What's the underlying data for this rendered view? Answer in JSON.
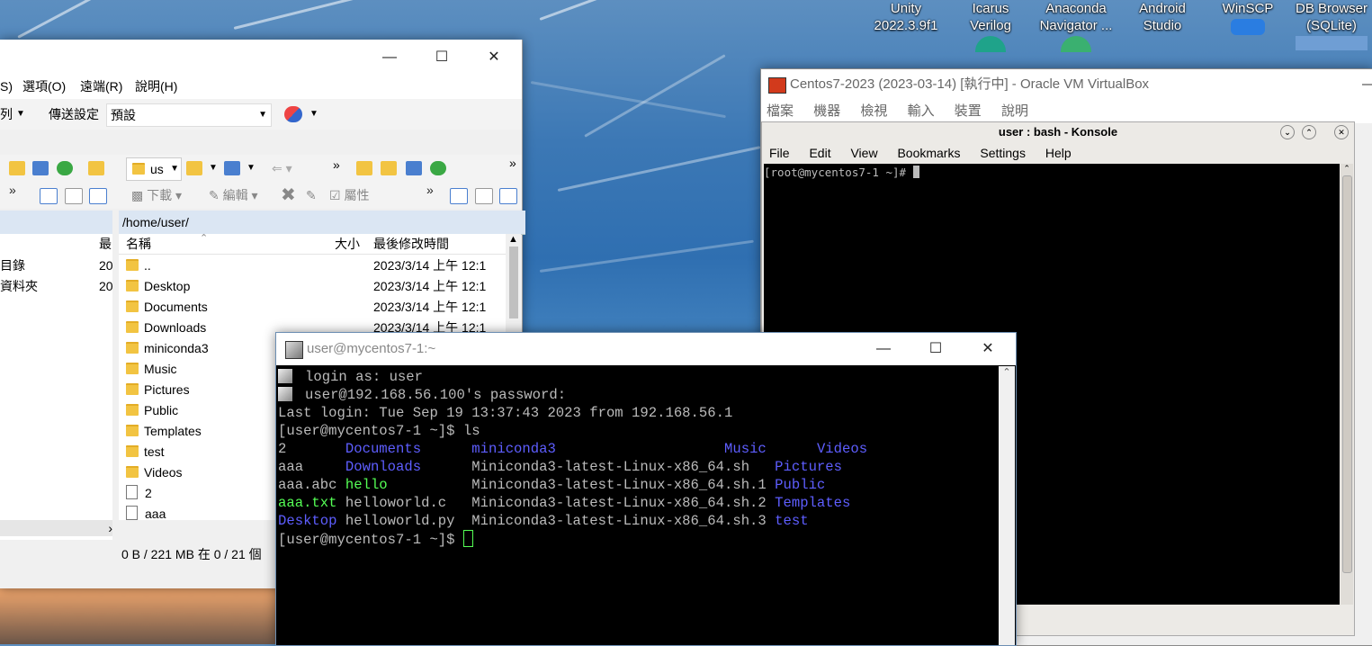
{
  "desktop": {
    "icons": [
      {
        "label1": "Unity",
        "label2": "2022.3.9f1"
      },
      {
        "label1": "Icarus",
        "label2": "Verilog"
      },
      {
        "label1": "Anaconda",
        "label2": "Navigator ..."
      },
      {
        "label1": "Android",
        "label2": "Studio"
      },
      {
        "label1": "WinSCP",
        "label2": ""
      },
      {
        "label1": "DB Browser",
        "label2": "(SQLite)"
      }
    ]
  },
  "winscp": {
    "menu": [
      "S)",
      "選項(O)",
      "遠端(R)",
      "說明(H)"
    ],
    "toolbar": {
      "left_cut": "列",
      "transfer_label": "傳送設定",
      "transfer_value": "預設"
    },
    "toolbar2": {
      "path_combo": "us",
      "download": "下載",
      "edit": "編輯",
      "properties": "屬性"
    },
    "left_panel": {
      "col_last": "最",
      "rows": [
        {
          "name": "目錄",
          "date": "20"
        },
        {
          "name": "資料夾",
          "date": "20"
        }
      ]
    },
    "right_panel": {
      "path": "/home/user/",
      "headers": {
        "name": "名稱",
        "size": "大小",
        "modified": "最後修改時間"
      },
      "rows": [
        {
          "type": "parent",
          "name": "..",
          "modified": "2023/3/14 上午 12:1"
        },
        {
          "type": "folder",
          "name": "Desktop",
          "modified": "2023/3/14 上午 12:1"
        },
        {
          "type": "folder",
          "name": "Documents",
          "modified": "2023/3/14 上午 12:1"
        },
        {
          "type": "folder",
          "name": "Downloads",
          "modified": "2023/3/14 上午 12:1"
        },
        {
          "type": "folder",
          "name": "miniconda3",
          "modified": ""
        },
        {
          "type": "folder",
          "name": "Music",
          "modified": ""
        },
        {
          "type": "folder",
          "name": "Pictures",
          "modified": ""
        },
        {
          "type": "folder",
          "name": "Public",
          "modified": ""
        },
        {
          "type": "folder",
          "name": "Templates",
          "modified": ""
        },
        {
          "type": "folder",
          "name": "test",
          "modified": ""
        },
        {
          "type": "folder",
          "name": "Videos",
          "modified": ""
        },
        {
          "type": "file",
          "name": "2",
          "modified": ""
        },
        {
          "type": "file",
          "name": "aaa",
          "modified": ""
        }
      ]
    },
    "status": "0 B / 221 MB 在 0 / 21 個"
  },
  "putty": {
    "title": "user@mycentos7-1:~",
    "lines": [
      {
        "segments": [
          {
            "t": "login as: user",
            "c": "gray"
          }
        ],
        "icon": true
      },
      {
        "segments": [
          {
            "t": "user@192.168.56.100's password:",
            "c": "gray"
          }
        ],
        "icon": true
      },
      {
        "segments": [
          {
            "t": "Last login: Tue Sep 19 13:37:43 2023 from 192.168.56.1",
            "c": "gray"
          }
        ]
      },
      {
        "segments": [
          {
            "t": "[user@mycentos7-1 ~]$ ls",
            "c": "gray"
          }
        ]
      },
      {
        "segments": [
          {
            "t": "2       ",
            "c": "gray"
          },
          {
            "t": "Documents",
            "c": "blue"
          },
          {
            "t": "      ",
            "c": "gray"
          },
          {
            "t": "miniconda3",
            "c": "blue"
          },
          {
            "t": "                    ",
            "c": "gray"
          },
          {
            "t": "Music",
            "c": "blue"
          },
          {
            "t": "      ",
            "c": "gray"
          },
          {
            "t": "Videos",
            "c": "blue"
          }
        ]
      },
      {
        "segments": [
          {
            "t": "aaa     ",
            "c": "gray"
          },
          {
            "t": "Downloads",
            "c": "blue"
          },
          {
            "t": "      Miniconda3-latest-Linux-x86_64.sh   ",
            "c": "gray"
          },
          {
            "t": "Pictures",
            "c": "blue"
          }
        ]
      },
      {
        "segments": [
          {
            "t": "aaa.abc ",
            "c": "gray"
          },
          {
            "t": "hello",
            "c": "green"
          },
          {
            "t": "          Miniconda3-latest-Linux-x86_64.sh.1 ",
            "c": "gray"
          },
          {
            "t": "Public",
            "c": "blue"
          }
        ]
      },
      {
        "segments": [
          {
            "t": "aaa.txt",
            "c": "green"
          },
          {
            "t": " helloworld.c   Miniconda3-latest-Linux-x86_64.sh.2 ",
            "c": "gray"
          },
          {
            "t": "Templates",
            "c": "blue"
          }
        ]
      },
      {
        "segments": [
          {
            "t": "Desktop",
            "c": "blue"
          },
          {
            "t": " helloworld.py  Miniconda3-latest-Linux-x86_64.sh.3 ",
            "c": "gray"
          },
          {
            "t": "test",
            "c": "blue"
          }
        ]
      },
      {
        "segments": [
          {
            "t": "[user@mycentos7-1 ~]$ ",
            "c": "gray"
          }
        ],
        "cursor": true
      }
    ]
  },
  "vbox": {
    "title": "Centos7-2023 (2023-03-14) [執行中] - Oracle VM VirtualBox",
    "menu": [
      "檔案",
      "機器",
      "檢視",
      "輸入",
      "裝置",
      "說明"
    ],
    "konsole": {
      "title": "user : bash - Konsole",
      "menu": [
        "File",
        "Edit",
        "View",
        "Bookmarks",
        "Settings",
        "Help"
      ],
      "prompt": "[root@mycentos7-1 ~]# "
    }
  },
  "colors": {
    "term_gray": "#bbbbbb",
    "term_blue": "#5e5eff",
    "term_green": "#55ff55",
    "folder": "#f2c442"
  }
}
